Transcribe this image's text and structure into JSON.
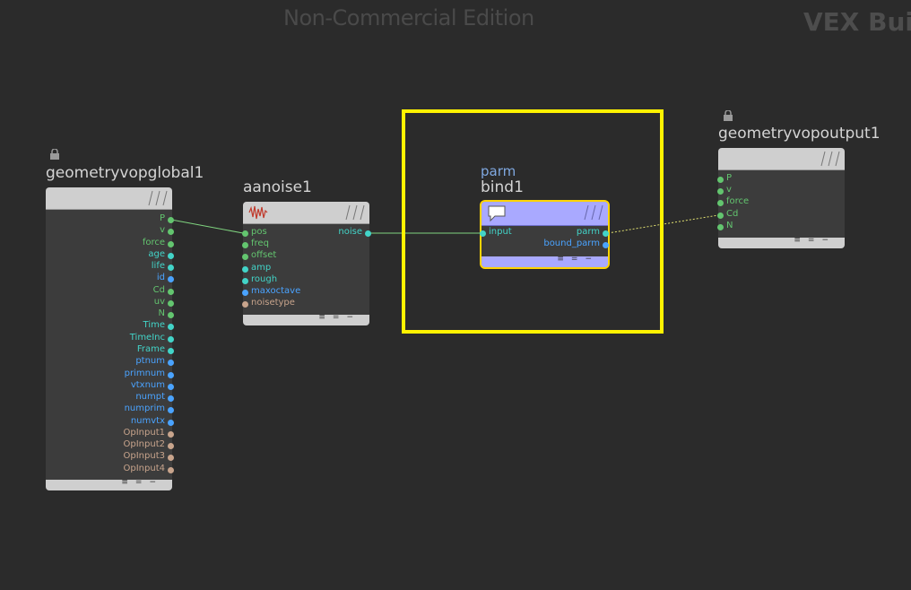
{
  "watermark": "Non-Commercial Edition",
  "context_label": "VEX Buil",
  "colors": {
    "background": "#2b2b2b",
    "wire": "#7fd37f",
    "selection": "#fff200",
    "bind_node": "#8c8cff",
    "port_green": "#63c56f",
    "port_cyan": "#42d4c8",
    "port_blue": "#4aa3ff",
    "port_tan": "#c8a48c"
  },
  "nodes": {
    "global": {
      "name": "geometryvopglobal1",
      "locked": true,
      "outputs": [
        {
          "label": "P",
          "color": "#63c56f",
          "text_color": "#63c56f"
        },
        {
          "label": "v",
          "color": "#63c56f",
          "text_color": "#63c56f"
        },
        {
          "label": "force",
          "color": "#63c56f",
          "text_color": "#63c56f"
        },
        {
          "label": "age",
          "color": "#42d4c8",
          "text_color": "#42d4c8"
        },
        {
          "label": "life",
          "color": "#42d4c8",
          "text_color": "#42d4c8"
        },
        {
          "label": "id",
          "color": "#4aa3ff",
          "text_color": "#4aa3ff"
        },
        {
          "label": "Cd",
          "color": "#63c56f",
          "text_color": "#63c56f"
        },
        {
          "label": "uv",
          "color": "#63c56f",
          "text_color": "#63c56f"
        },
        {
          "label": "N",
          "color": "#63c56f",
          "text_color": "#63c56f"
        },
        {
          "label": "Time",
          "color": "#42d4c8",
          "text_color": "#42d4c8"
        },
        {
          "label": "TimeInc",
          "color": "#42d4c8",
          "text_color": "#42d4c8"
        },
        {
          "label": "Frame",
          "color": "#42d4c8",
          "text_color": "#42d4c8"
        },
        {
          "label": "ptnum",
          "color": "#4aa3ff",
          "text_color": "#4aa3ff"
        },
        {
          "label": "primnum",
          "color": "#4aa3ff",
          "text_color": "#4aa3ff"
        },
        {
          "label": "vtxnum",
          "color": "#4aa3ff",
          "text_color": "#4aa3ff"
        },
        {
          "label": "numpt",
          "color": "#4aa3ff",
          "text_color": "#4aa3ff"
        },
        {
          "label": "numprim",
          "color": "#4aa3ff",
          "text_color": "#4aa3ff"
        },
        {
          "label": "numvtx",
          "color": "#4aa3ff",
          "text_color": "#4aa3ff"
        },
        {
          "label": "OpInput1",
          "color": "#c8a48c",
          "text_color": "#c8a48c"
        },
        {
          "label": "OpInput2",
          "color": "#c8a48c",
          "text_color": "#c8a48c"
        },
        {
          "label": "OpInput3",
          "color": "#c8a48c",
          "text_color": "#c8a48c"
        },
        {
          "label": "OpInput4",
          "color": "#c8a48c",
          "text_color": "#c8a48c"
        }
      ]
    },
    "noise": {
      "name": "aanoise1",
      "icon": "noise-wave-icon",
      "inputs": [
        {
          "label": "pos",
          "color": "#63c56f",
          "text_color": "#63c56f"
        },
        {
          "label": "freq",
          "color": "#63c56f",
          "text_color": "#63c56f"
        },
        {
          "label": "offset",
          "color": "#63c56f",
          "text_color": "#63c56f"
        },
        {
          "label": "amp",
          "color": "#42d4c8",
          "text_color": "#42d4c8"
        },
        {
          "label": "rough",
          "color": "#42d4c8",
          "text_color": "#42d4c8"
        },
        {
          "label": "maxoctave",
          "color": "#4aa3ff",
          "text_color": "#4aa3ff"
        },
        {
          "label": "noisetype",
          "color": "#c8a48c",
          "text_color": "#c8a48c"
        }
      ],
      "outputs": [
        {
          "label": "noise",
          "color": "#42d4c8",
          "text_color": "#42d4c8"
        }
      ]
    },
    "bind": {
      "type_label": "parm",
      "name": "bind1",
      "icon": "speech-bubble-icon",
      "inputs": [
        {
          "label": "input",
          "color": "#42d4c8",
          "text_color": "#42d4c8"
        }
      ],
      "outputs": [
        {
          "label": "parm",
          "color": "#42d4c8",
          "text_color": "#42d4c8"
        },
        {
          "label": "bound_parm",
          "color": "#4aa3ff",
          "text_color": "#4aa3ff"
        }
      ]
    },
    "output": {
      "name": "geometryvopoutput1",
      "locked": true,
      "inputs": [
        {
          "label": "P",
          "color": "#63c56f",
          "text_color": "#63c56f"
        },
        {
          "label": "v",
          "color": "#63c56f",
          "text_color": "#63c56f"
        },
        {
          "label": "force",
          "color": "#63c56f",
          "text_color": "#63c56f"
        },
        {
          "label": "Cd",
          "color": "#63c56f",
          "text_color": "#63c56f"
        },
        {
          "label": "N",
          "color": "#63c56f",
          "text_color": "#63c56f"
        }
      ]
    }
  }
}
